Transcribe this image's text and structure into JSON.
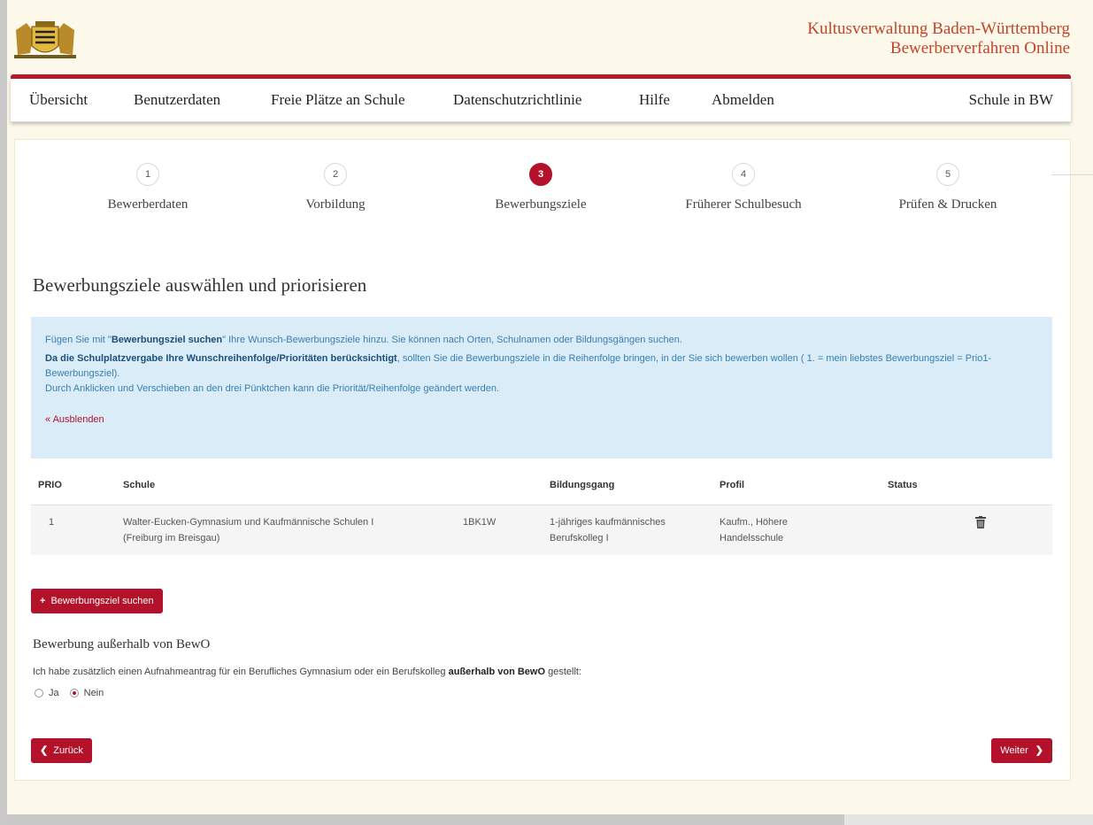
{
  "header": {
    "brand_line1": "Kultusverwaltung Baden-Württemberg",
    "brand_line2": "Bewerberverfahren Online"
  },
  "nav": {
    "items": [
      "Übersicht",
      "Benutzerdaten",
      "Freie Plätze an Schule",
      "Datenschutzrichtlinie",
      "Hilfe",
      "Abmelden"
    ],
    "right": "Schule in BW"
  },
  "stepper": {
    "steps": [
      {
        "num": "1",
        "label": "Bewerberdaten"
      },
      {
        "num": "2",
        "label": "Vorbildung"
      },
      {
        "num": "3",
        "label": "Bewerbungsziele",
        "active": true
      },
      {
        "num": "4",
        "label": "Früherer Schulbesuch"
      },
      {
        "num": "5",
        "label": "Prüfen & Drucken"
      }
    ]
  },
  "page_title": "Bewerbungsziele auswählen und priorisieren",
  "info": {
    "line1_pre": "Fügen Sie mit \"",
    "line1_bold": "Bewerbungsziel suchen",
    "line1_post": "\" Ihre Wunsch-Bewerbungsziele hinzu. Sie können nach Orten, Schulnamen oder Bildungsgängen suchen.",
    "line2_bold": "Da die Schulplatzvergabe Ihre Wunschreihenfolge/Prioritäten berücksichtigt",
    "line2_post": ", sollten Sie die Bewerbungsziele in die Reihenfolge bringen, in der Sie sich bewerben wollen ( 1. = mein liebstes Bewerbungsziel = Prio1-Bewerbungsziel).",
    "line3": "Durch Anklicken und Verschieben an den drei Pünktchen kann die Priorität/Reihenfolge geändert werden.",
    "hide_link": "« Ausblenden"
  },
  "table": {
    "headers": {
      "prio": "PRIO",
      "schule": "Schule",
      "bildungsgang": "Bildungsgang",
      "profil": "Profil",
      "status": "Status"
    },
    "rows": [
      {
        "prio": "1",
        "schule_line1": "Walter-Eucken-Gymnasium und Kaufmännische Schulen I",
        "schule_line2": "(Freiburg im Breisgau)",
        "code": "1BK1W",
        "bildungsgang_line1": "1-jähriges kaufmännisches",
        "bildungsgang_line2": "Berufskolleg I",
        "profil_line1": "Kaufm., Höhere",
        "profil_line2": "Handelsschule",
        "status": ""
      }
    ]
  },
  "search_button": {
    "icon": "+",
    "label": "Bewerbungsziel suchen"
  },
  "extern": {
    "title": "Bewerbung außerhalb von BewO",
    "text_pre": "Ich habe zusätzlich einen Aufnahmeantrag für ein Berufliches Gymnasium oder ein Berufskolleg ",
    "text_bold": "außerhalb von BewO",
    "text_post": " gestellt:",
    "options": [
      "Ja",
      "Nein"
    ],
    "selected": "Nein"
  },
  "back_button": {
    "icon": "❮",
    "label": "Zurück"
  },
  "next_button": {
    "label": "Weiter",
    "icon": "❯"
  },
  "colors": {
    "accent": "#b3122a",
    "info_bg": "#d9ecf7",
    "page_bg": "#fdf9ea",
    "brand_text": "#c4432b"
  }
}
